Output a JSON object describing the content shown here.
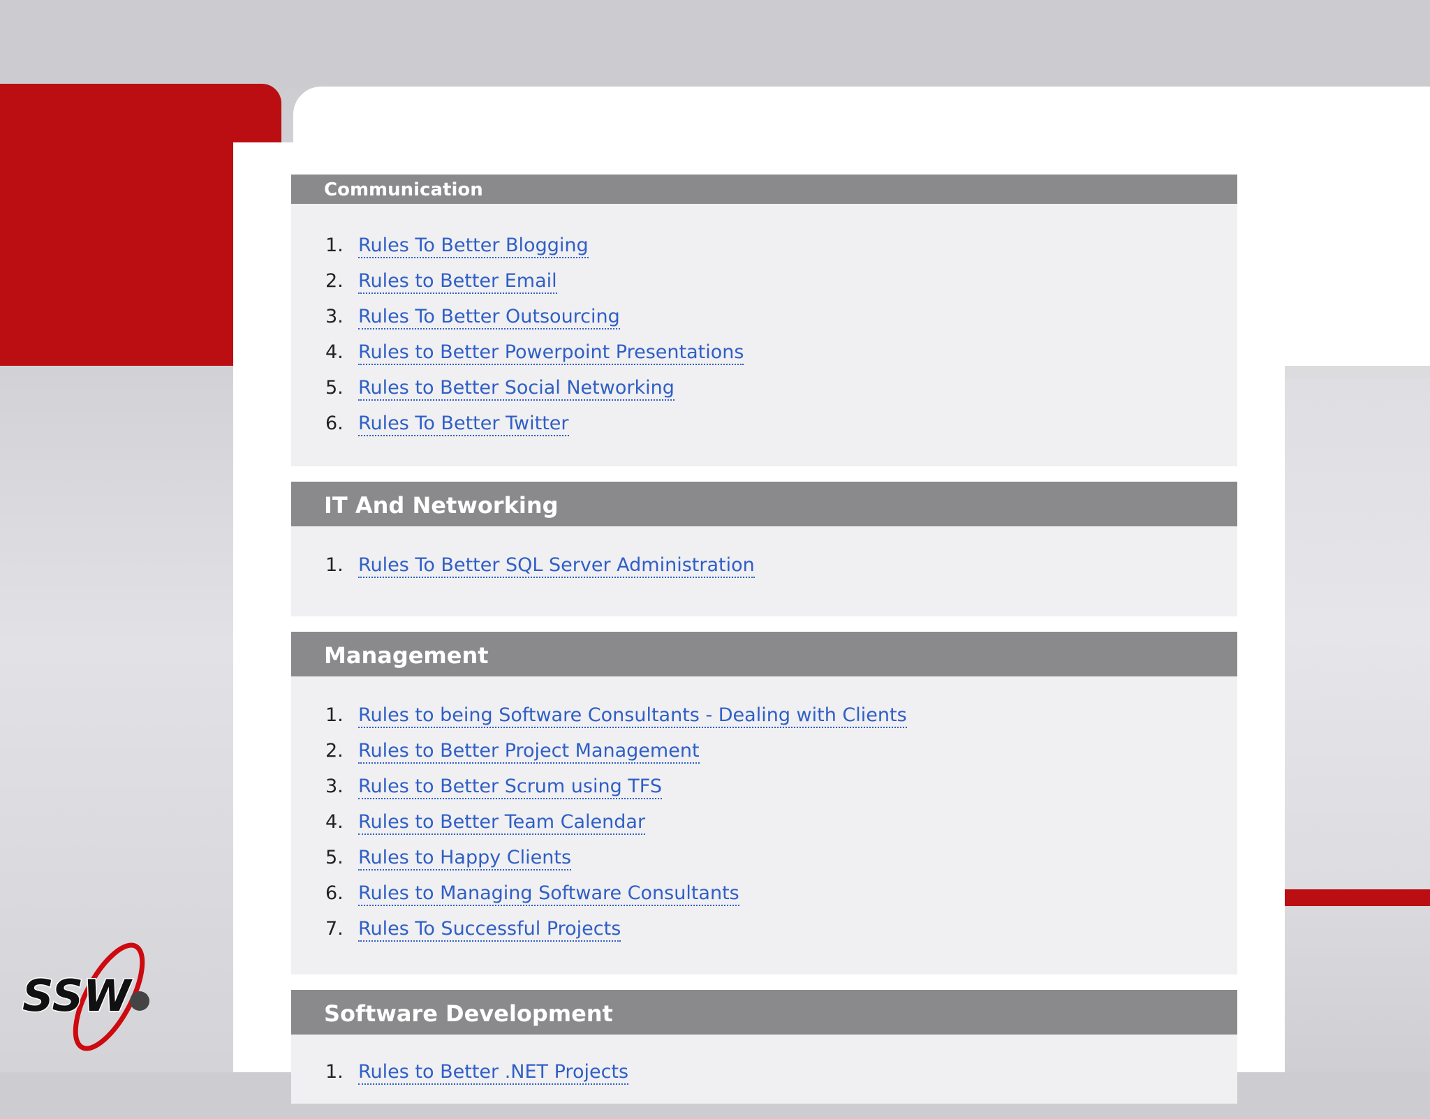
{
  "logo": {
    "text": "SSW",
    "colors": {
      "ring": "#cc0a10",
      "text": "#111111",
      "globe": "#444444"
    }
  },
  "colors": {
    "brand_red": "#bb0e12",
    "section_header": "#8a8a8c",
    "section_body": "#f0eff1",
    "link": "#2f5fc6"
  },
  "sections": [
    {
      "title": "Communication",
      "items": [
        {
          "num": "1.",
          "label": "Rules To Better Blogging"
        },
        {
          "num": "2.",
          "label": "Rules to Better Email"
        },
        {
          "num": "3.",
          "label": "Rules To Better Outsourcing"
        },
        {
          "num": "4.",
          "label": "Rules to Better Powerpoint Presentations"
        },
        {
          "num": "5.",
          "label": "Rules to Better Social Networking"
        },
        {
          "num": "6.",
          "label": "Rules To Better Twitter"
        }
      ]
    },
    {
      "title": "IT And Networking",
      "items": [
        {
          "num": "1.",
          "label": "Rules To Better SQL Server Administration"
        }
      ]
    },
    {
      "title": "Management",
      "items": [
        {
          "num": "1.",
          "label": "Rules to being Software Consultants - Dealing with Clients"
        },
        {
          "num": "2.",
          "label": "Rules to Better Project Management"
        },
        {
          "num": "3.",
          "label": "Rules to Better Scrum using TFS"
        },
        {
          "num": "4.",
          "label": "Rules to Better Team Calendar"
        },
        {
          "num": "5.",
          "label": "Rules to Happy Clients"
        },
        {
          "num": "6.",
          "label": "Rules to Managing Software Consultants"
        },
        {
          "num": "7.",
          "label": "Rules To Successful Projects"
        }
      ]
    },
    {
      "title": "Software Development",
      "items": [
        {
          "num": "1.",
          "label": "Rules to Better .NET Projects"
        }
      ]
    }
  ]
}
